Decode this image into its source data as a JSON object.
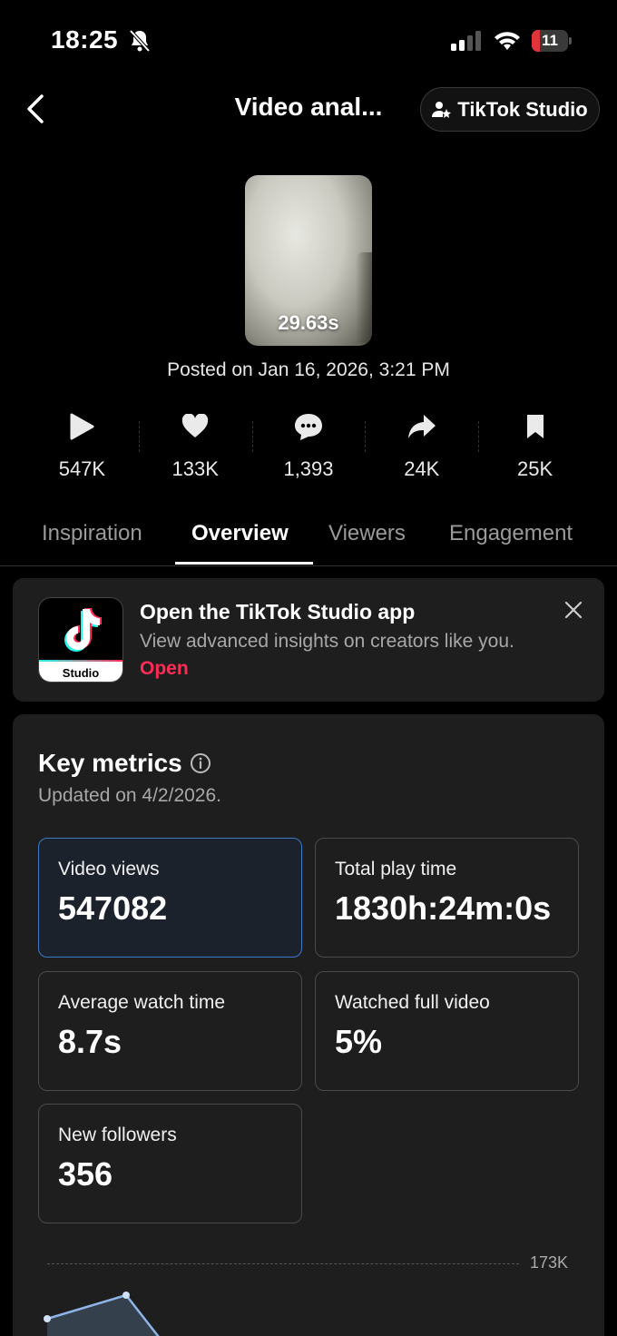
{
  "status_bar": {
    "time": "18:25",
    "battery": "11"
  },
  "header": {
    "title": "Video anal...",
    "studio_button": "TikTok Studio"
  },
  "video": {
    "duration": "29.63s",
    "posted": "Posted on Jan 16, 2026, 3:21 PM"
  },
  "stats": [
    {
      "icon": "play-icon",
      "value": "547K"
    },
    {
      "icon": "heart-icon",
      "value": "133K"
    },
    {
      "icon": "comment-icon",
      "value": "1,393"
    },
    {
      "icon": "share-icon",
      "value": "24K"
    },
    {
      "icon": "bookmark-icon",
      "value": "25K"
    }
  ],
  "tabs": [
    {
      "label": "Inspiration"
    },
    {
      "label": "Overview",
      "active": true
    },
    {
      "label": "Viewers"
    },
    {
      "label": "Engagement"
    }
  ],
  "banner": {
    "title": "Open the TikTok Studio app",
    "text": "View advanced insights on creators like you.",
    "link": "Open",
    "icon_label": "Studio"
  },
  "key_metrics": {
    "title": "Key metrics",
    "updated": "Updated on 4/2/2026.",
    "tiles": [
      {
        "label": "Video views",
        "value": "547082",
        "selected": true
      },
      {
        "label": "Total play time",
        "value": "1830h:24m:0s"
      },
      {
        "label": "Average watch time",
        "value": "8.7s"
      },
      {
        "label": "Watched full video",
        "value": "5%"
      },
      {
        "label": "New followers",
        "value": "356"
      }
    ],
    "chart_max_label": "173K"
  },
  "colors": {
    "accent": "#fe2c55",
    "selected_border": "#3b78c8",
    "battery_low": "#e0343a"
  }
}
